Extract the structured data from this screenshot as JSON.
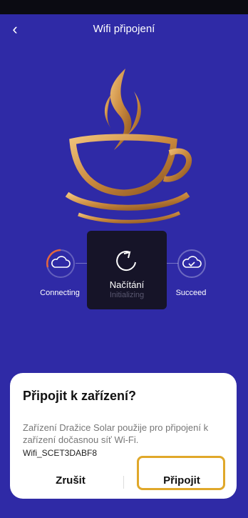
{
  "header": {
    "title": "Wifi připojení",
    "back_icon": "chevron-left-icon"
  },
  "steps": [
    {
      "label": "Connecting",
      "icon": "cloud-icon"
    },
    {
      "label": "Succeed",
      "icon": "cloud-check-icon"
    }
  ],
  "loader": {
    "title": "Načítání",
    "subtitle": "Initializing"
  },
  "dialog": {
    "title": "Připojit k zařízení?",
    "body": "Zařízení Dražice Solar použije pro připojení k zařízení dočasnou síť Wi-Fi.",
    "ssid": "Wifi_SCET3DABF8",
    "cancel_label": "Zrušit",
    "confirm_label": "Připojit"
  },
  "colors": {
    "background": "#2f2aa6",
    "highlight": "#e0a82a",
    "cup_gold": "#c9893e"
  }
}
